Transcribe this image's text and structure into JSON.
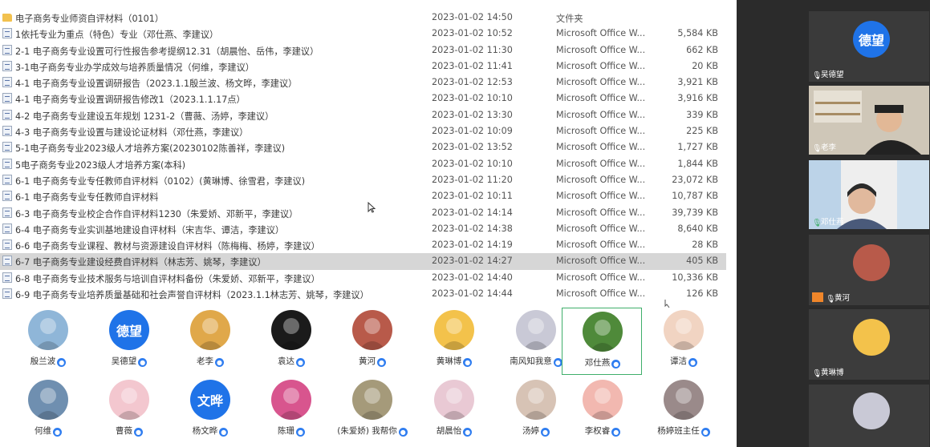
{
  "files": [
    {
      "name": "电子商务专业师资自评材料（0101）",
      "date": "2023-01-02 14:50",
      "type": "文件夹",
      "size": "",
      "icon": "folder-icon"
    },
    {
      "name": "1依托专业为重点（特色）专业（邓仕燕、李建议）",
      "date": "2023-01-02 10:52",
      "type": "Microsoft Office W...",
      "size": "5,584 KB",
      "icon": "word-doc-icon"
    },
    {
      "name": "2-1 电子商务专业设置可行性报告参考提纲12.31（胡晨怡、岳伟，李建议）",
      "date": "2023-01-02 11:30",
      "type": "Microsoft Office W...",
      "size": "662 KB",
      "icon": "word-doc-icon"
    },
    {
      "name": "3-1电子商务专业办学成效与培养质量情况（何维，李建议）",
      "date": "2023-01-02 11:41",
      "type": "Microsoft Office W...",
      "size": "20 KB",
      "icon": "word-doc-icon"
    },
    {
      "name": "4-1 电子商务专业设置调研报告（2023.1.1殷兰波、杨文晔，李建议）",
      "date": "2023-01-02 12:53",
      "type": "Microsoft Office W...",
      "size": "3,921 KB",
      "icon": "word-doc-icon"
    },
    {
      "name": "4-1 电子商务专业设置调研报告修改1（2023.1.1.17点）",
      "date": "2023-01-02 10:10",
      "type": "Microsoft Office W...",
      "size": "3,916 KB",
      "icon": "word-doc-icon"
    },
    {
      "name": "4-2 电子商务专业建设五年规划 1231-2（曹薇、汤婷，李建议）",
      "date": "2023-01-02 13:30",
      "type": "Microsoft Office W...",
      "size": "339 KB",
      "icon": "word-doc-icon"
    },
    {
      "name": "4-3 电子商务专业设置与建设论证材料（邓仕燕，李建议）",
      "date": "2023-01-02 10:09",
      "type": "Microsoft Office W...",
      "size": "225 KB",
      "icon": "word-doc-icon"
    },
    {
      "name": "5-1电子商务专业2023级人才培养方案(20230102陈善祥，李建议)",
      "date": "2023-01-02 13:52",
      "type": "Microsoft Office W...",
      "size": "1,727 KB",
      "icon": "word-doc-icon"
    },
    {
      "name": "5电子商务专业2023级人才培养方案(本科)",
      "date": "2023-01-02 10:10",
      "type": "Microsoft Office W...",
      "size": "1,844 KB",
      "icon": "word-doc-icon"
    },
    {
      "name": "6-1 电子商务专业专任教师自评材料（0102）(黄琳博、徐雪君，李建议)",
      "date": "2023-01-02 11:20",
      "type": "Microsoft Office W...",
      "size": "23,072 KB",
      "icon": "word-doc-icon"
    },
    {
      "name": "6-1 电子商务专业专任教师自评材料",
      "date": "2023-01-02 10:11",
      "type": "Microsoft Office W...",
      "size": "10,787 KB",
      "icon": "word-doc-icon"
    },
    {
      "name": "6-3 电子商务专业校企合作自评材料1230（朱爱娇、邓新平，李建议）",
      "date": "2023-01-02 14:14",
      "type": "Microsoft Office W...",
      "size": "39,739 KB",
      "icon": "word-doc-icon"
    },
    {
      "name": "6-4 电子商务专业实训基地建设自评材料（宋吉华、谭洁，李建议）",
      "date": "2023-01-02 14:38",
      "type": "Microsoft Office W...",
      "size": "8,640 KB",
      "icon": "word-doc-icon"
    },
    {
      "name": "6-6 电子商务专业课程、教材与资源建设自评材料（陈梅梅、杨婷，李建议）",
      "date": "2023-01-02 14:19",
      "type": "Microsoft Office W...",
      "size": "28 KB",
      "icon": "word-doc-icon"
    },
    {
      "name": "6-7 电子商务专业建设经费自评材料（林志芳、姚琴，李建议）",
      "date": "2023-01-02 14:27",
      "type": "Microsoft Office W...",
      "size": "405 KB",
      "icon": "word-doc-icon",
      "selected": true
    },
    {
      "name": "6-8 电子商务专业技术服务与培训自评材料备份（朱爱娇、邓新平，李建议）",
      "date": "2023-01-02 14:40",
      "type": "Microsoft Office W...",
      "size": "10,336 KB",
      "icon": "word-doc-icon"
    },
    {
      "name": "6-9 电子商务专业培养质量基础和社会声誉自评材料（2023.1.1林志芳、姚琴，李建议）",
      "date": "2023-01-02 14:44",
      "type": "Microsoft Office W...",
      "size": "126 KB",
      "icon": "word-doc-icon"
    }
  ],
  "participants": [
    {
      "name": "殷兰波",
      "avatar": "flower-avatar",
      "color": "#8fb6d8"
    },
    {
      "name": "吴德望",
      "avatar": "text-avatar",
      "text": "德望",
      "color": "#1f73e8"
    },
    {
      "name": "老李",
      "avatar": "sunset-avatar",
      "color": "#e0a84a"
    },
    {
      "name": "袁达",
      "avatar": "superman-logo-avatar",
      "color": "#1b1b1b"
    },
    {
      "name": "黄河",
      "avatar": "person-avatar",
      "color": "#b85a4a"
    },
    {
      "name": "黄琳博",
      "avatar": "tiger-avatar",
      "color": "#f3c24b"
    },
    {
      "name": "南风知我意",
      "avatar": "anime-girl-avatar",
      "color": "#c9c9d6"
    },
    {
      "name": "邓仕燕",
      "avatar": "garden-avatar",
      "color": "#4f8a3a"
    },
    {
      "name": "谭洁",
      "avatar": "cartoon-girl-avatar",
      "color": "#f1d4c2"
    },
    {
      "name": "何维",
      "avatar": "eiffel-tower-avatar",
      "color": "#6f8fb0"
    },
    {
      "name": "曹薇",
      "avatar": "girl-pink-avatar",
      "color": "#f3c7cf"
    },
    {
      "name": "杨文晔",
      "avatar": "text-avatar",
      "text": "文晔",
      "color": "#1f73e8"
    },
    {
      "name": "陈珊",
      "avatar": "pink-flower-avatar",
      "color": "#d8558e"
    },
    {
      "name": "(朱爱娇) 我帮你",
      "avatar": "landscape-avatar",
      "color": "#a59a7a"
    },
    {
      "name": "胡晨怡",
      "avatar": "girl-sketch-avatar",
      "color": "#e9c9d4"
    },
    {
      "name": "汤婷",
      "avatar": "anime-face-avatar",
      "color": "#d7c3b5"
    },
    {
      "name": "李权睿",
      "avatar": "cartoon-boy-avatar",
      "color": "#f2b8b0"
    },
    {
      "name": "杨婷班主任",
      "avatar": "collage-avatar",
      "color": "#9a8a8a"
    }
  ],
  "side_panel": [
    {
      "name": "吴德望",
      "kind": "avatar",
      "text": "德望",
      "color": "#1f73e8"
    },
    {
      "name": "老李",
      "kind": "video"
    },
    {
      "name": "邓仕燕",
      "kind": "video"
    },
    {
      "name": "",
      "kind": "avatar",
      "color": "#b85a4a"
    },
    {
      "name": "黄河",
      "kind": "label"
    },
    {
      "name": "",
      "kind": "avatar",
      "color": "#f3c24b"
    },
    {
      "name": "黄琳博",
      "kind": "label"
    }
  ],
  "colors": {
    "highlight": "#3fae6a",
    "badge": "#2f7df0",
    "selected_row": "#d6d6d6",
    "side_bg": "#2b2b2b"
  }
}
